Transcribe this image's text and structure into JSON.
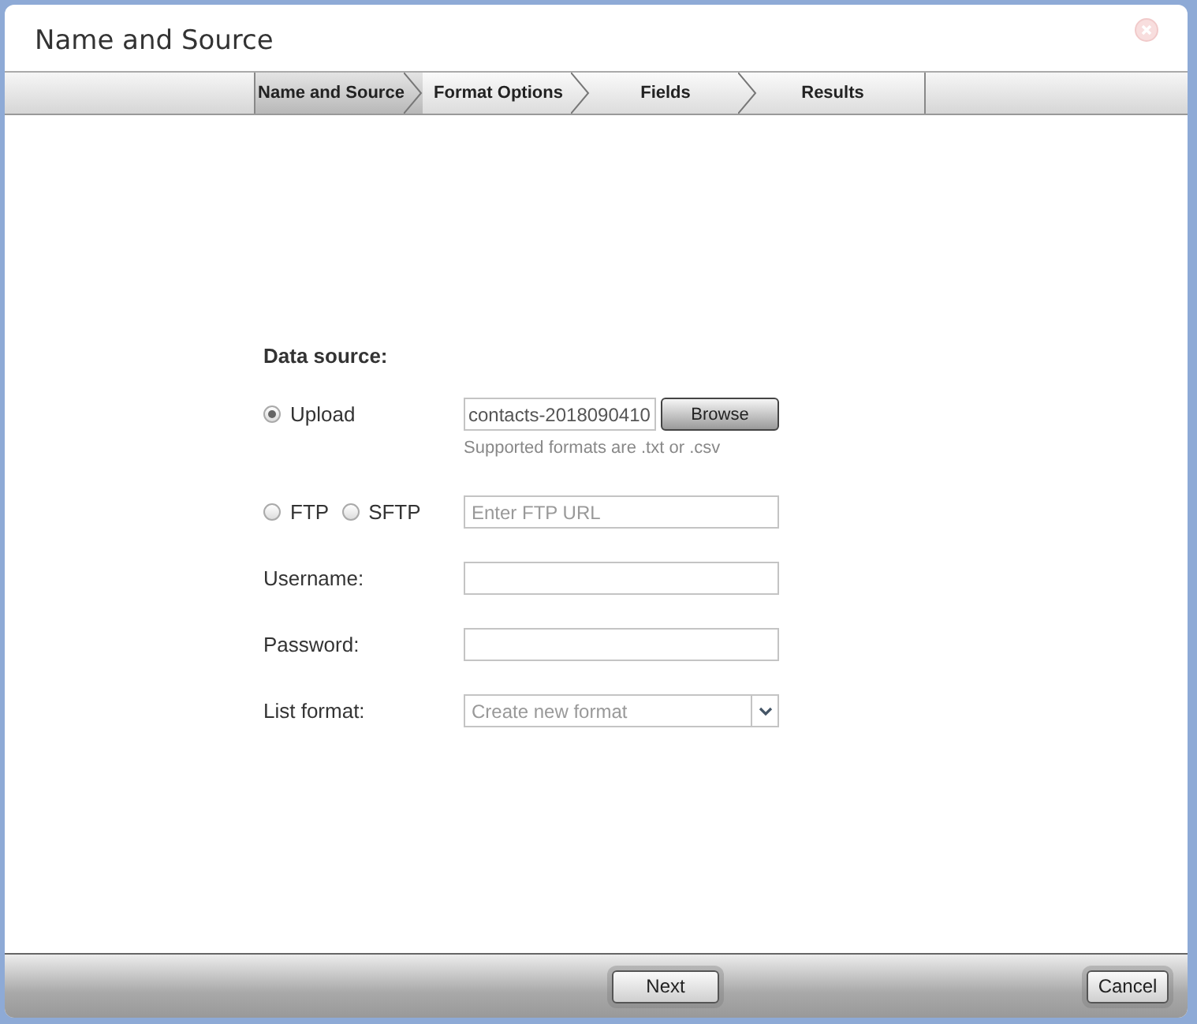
{
  "window": {
    "title": "Name and Source",
    "close_disabled": true
  },
  "steps": [
    {
      "label": "Name and Source",
      "selected": true
    },
    {
      "label": "Format Options",
      "selected": false
    },
    {
      "label": "Fields",
      "selected": false
    },
    {
      "label": "Results",
      "selected": false
    }
  ],
  "form": {
    "heading": "Data source:",
    "upload": {
      "label": "Upload",
      "selected": true,
      "value": "contacts-2018090410",
      "button": "Browse",
      "hint": "Supported formats are .txt or .csv"
    },
    "protocols": [
      {
        "label": "FTP",
        "selected": false
      },
      {
        "label": "SFTP",
        "selected": false
      }
    ],
    "ftp_url": {
      "placeholder": "Enter FTP URL"
    },
    "username": {
      "label": "Username:"
    },
    "password": {
      "label": "Password:"
    },
    "list_format": {
      "label": "List format:",
      "value": "Create new format"
    }
  },
  "footer": {
    "next": "Next",
    "cancel": "Cancel"
  }
}
